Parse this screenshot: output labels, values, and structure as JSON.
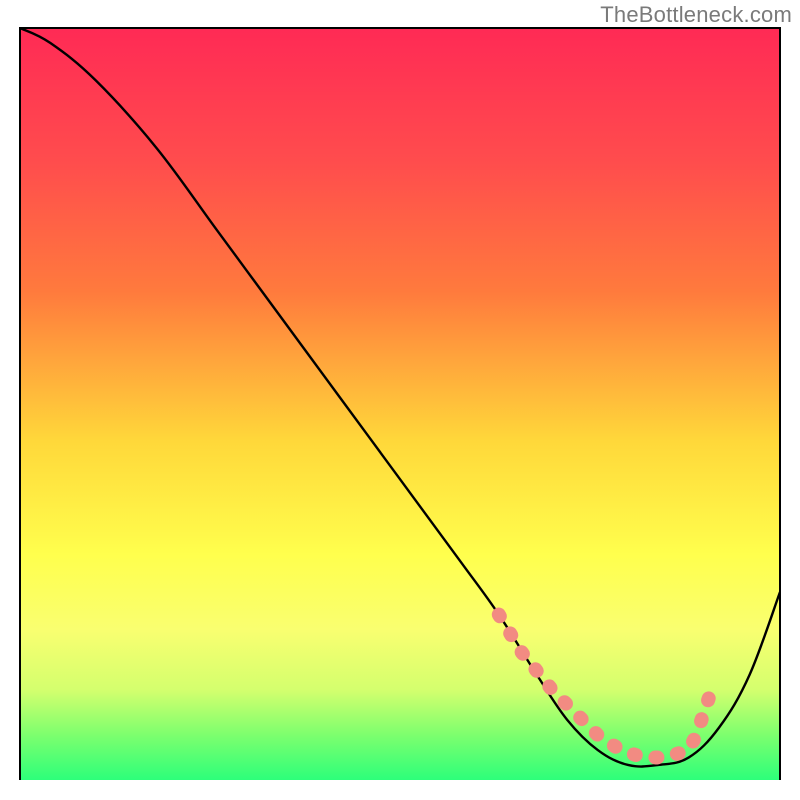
{
  "watermark": "TheBottleneck.com",
  "chart_data": {
    "type": "line",
    "title": "",
    "xlabel": "",
    "ylabel": "",
    "xlim": [
      0,
      100
    ],
    "ylim": [
      0,
      100
    ],
    "gradient_stops": [
      {
        "offset": 0,
        "color": "#ff2a55"
      },
      {
        "offset": 18,
        "color": "#ff4d4d"
      },
      {
        "offset": 35,
        "color": "#ff7a3d"
      },
      {
        "offset": 55,
        "color": "#ffd83a"
      },
      {
        "offset": 70,
        "color": "#ffff4d"
      },
      {
        "offset": 80,
        "color": "#f9ff70"
      },
      {
        "offset": 88,
        "color": "#d4ff6e"
      },
      {
        "offset": 94,
        "color": "#7dff6e"
      },
      {
        "offset": 100,
        "color": "#2dff7a"
      }
    ],
    "series": [
      {
        "name": "bottleneck-curve",
        "x": [
          0,
          4,
          10,
          18,
          26,
          34,
          42,
          50,
          58,
          63,
          68,
          72,
          76,
          80,
          84,
          88,
          92,
          96,
          100
        ],
        "y": [
          100,
          98,
          93,
          84,
          73,
          62,
          51,
          40,
          29,
          22,
          14,
          8,
          4,
          2,
          2,
          3,
          7,
          14,
          25
        ]
      }
    ],
    "optimal_zone": {
      "color": "#f28b82",
      "points_x": [
        63,
        66,
        70,
        73,
        76,
        79,
        82,
        85,
        88,
        89,
        90,
        91
      ],
      "points_y": [
        22,
        17,
        12,
        9,
        6,
        4,
        3,
        3,
        4,
        6,
        9,
        12
      ]
    }
  }
}
